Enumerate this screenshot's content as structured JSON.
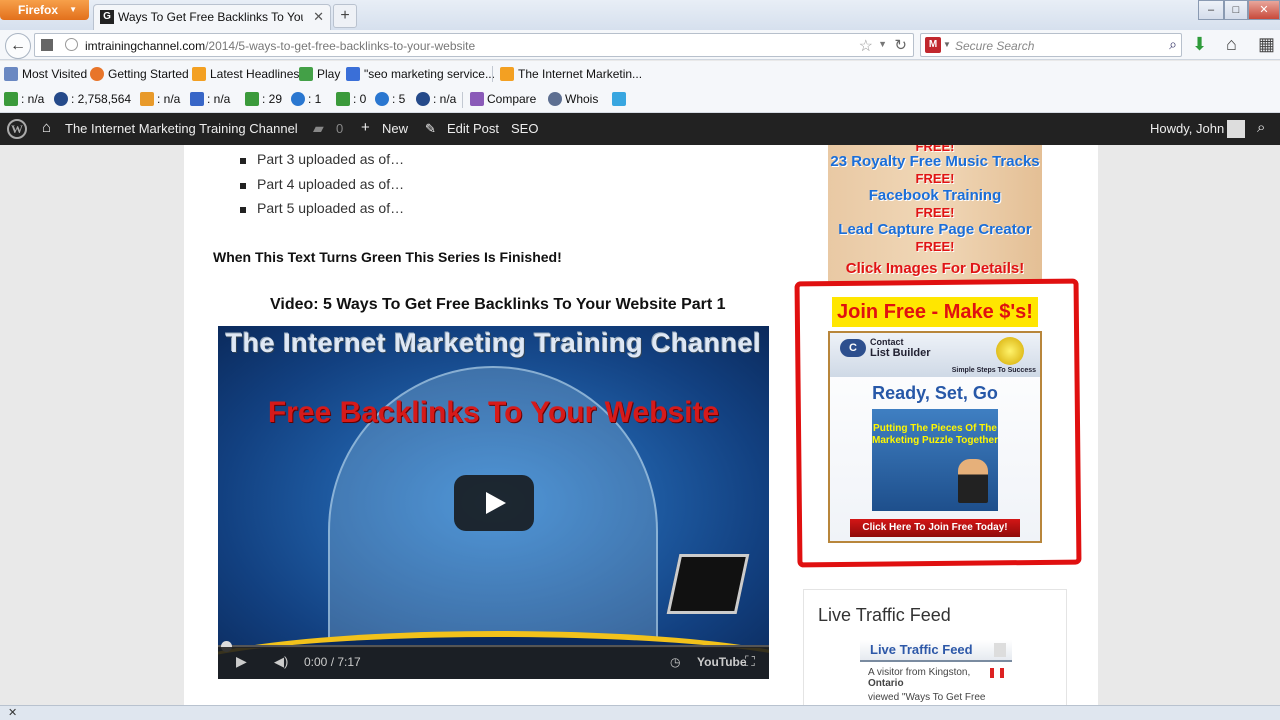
{
  "browser": {
    "menu_label": "Firefox",
    "tab_title": "Ways To Get Free Backlinks To Your We...",
    "tab_favicon_letter": "G",
    "url_host": "imtrainingchannel.com",
    "url_path": "/2014/5-ways-to-get-free-backlinks-to-your-website",
    "search_placeholder": "Secure Search",
    "search_engine_logo": "M"
  },
  "bookmarks": [
    {
      "label": "Most Visited",
      "icon": "bookmark-icon",
      "color": "#6a88c2"
    },
    {
      "label": "Getting Started",
      "icon": "firefox-icon",
      "color": "#e8752a"
    },
    {
      "label": "Latest Headlines",
      "icon": "rss-icon",
      "color": "#f3a022"
    },
    {
      "label": "Play",
      "icon": "play-store-icon",
      "color": "#43a047"
    },
    {
      "label": "\"seo marketing service...",
      "icon": "google-icon",
      "color": "#3a6fd8"
    },
    {
      "label": "The Internet Marketin...",
      "icon": "rss-icon",
      "color": "#f3a022"
    }
  ],
  "seo_toolbar": [
    {
      "value": ": n/a",
      "icon": "pagerank-icon",
      "color": "#3b9a3b"
    },
    {
      "value": ": 2,758,564",
      "icon": "alexa-icon",
      "color": "#254a8a"
    },
    {
      "value": ": n/a",
      "icon": "dmoz-icon",
      "color": "#e89a2a"
    },
    {
      "value": ": n/a",
      "icon": "alexa-alpha-icon",
      "color": "#3866c7"
    },
    {
      "value": ": 29",
      "icon": "google-index-icon",
      "color": "#3b9a3b"
    },
    {
      "value": ": 1",
      "icon": "bing-icon",
      "color": "#2a77d0"
    },
    {
      "value": ": 0",
      "icon": "google-backlinks-icon",
      "color": "#3b9a3b"
    },
    {
      "value": ": 5",
      "icon": "bing-backlinks-icon",
      "color": "#2a77d0"
    },
    {
      "value": ": n/a",
      "icon": "archive-icon",
      "color": "#254a8a"
    },
    {
      "value": "Compare",
      "icon": "compare-icon",
      "color": "#8a5ab8"
    },
    {
      "value": "Whois",
      "icon": "whois-icon",
      "color": "#5d6f91"
    },
    {
      "value": "",
      "icon": "twitter-icon",
      "color": "#38a6e0"
    }
  ],
  "wp_admin": {
    "site_name": "The Internet Marketing Training Channel",
    "comments_count": "0",
    "new_label": "New",
    "edit_label": "Edit Post",
    "seo_label": "SEO",
    "greeting": "Howdy, John"
  },
  "post": {
    "list_items": [
      "Part 3 uploaded as of…",
      "Part 4 uploaded as of…",
      "Part 5 uploaded as of…"
    ],
    "notice": "When This Text Turns Green This Series Is Finished!",
    "video_title": "Video: 5 Ways To Get Free Backlinks To Your Website Part 1",
    "video": {
      "brand_text": "The Internet Marketing Training Channel",
      "headline": "Free Backlinks To Your Website",
      "time": "0:00 / 7:17",
      "provider": "YouTube",
      "progress_fraction": 0
    }
  },
  "sidebar": {
    "ad_top_lines": [
      {
        "text": "FREE!",
        "style": "free"
      },
      {
        "text": "23 Royalty Free Music Tracks",
        "style": "blue"
      },
      {
        "text": "FREE!",
        "style": "free"
      },
      {
        "text": "Facebook Training",
        "style": "blue"
      },
      {
        "text": "FREE!",
        "style": "free"
      },
      {
        "text": "Lead Capture Page Creator",
        "style": "blue"
      },
      {
        "text": "FREE!",
        "style": "free"
      },
      {
        "text": "Click Images For Details!",
        "style": "red"
      }
    ],
    "join_banner": "Join Free - Make $'s!",
    "ad2": {
      "logo_text": "C",
      "title_small": "Contact",
      "title": "List Builder",
      "tagline": "Simple Steps To Success",
      "product": "Ready, Set, Go",
      "puzzle_text": "Putting The Pieces Of The Marketing Puzzle Together",
      "cta": "Click Here To Join Free Today!"
    },
    "feed": {
      "heading": "Live Traffic Feed",
      "widget_title": "Live Traffic Feed",
      "line1": "A visitor from Kingston,",
      "line2": "Ontario",
      "line3": "viewed \"Ways To Get Free"
    }
  },
  "colors": {
    "wp_bar": "#222222",
    "firefox_orange": "#e2701c",
    "highlight_red": "#e01010",
    "banner_yellow": "#ffe600"
  }
}
